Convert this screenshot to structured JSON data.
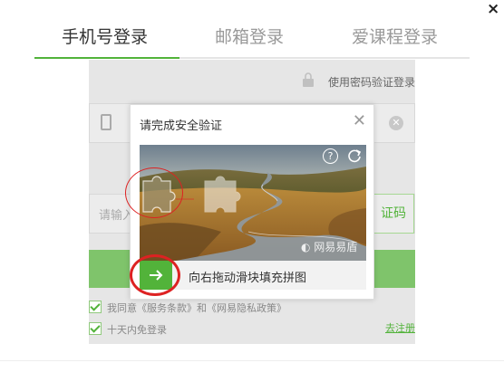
{
  "window": {
    "close_symbol": "×"
  },
  "tabs": [
    {
      "label": "手机号登录",
      "active": true
    },
    {
      "label": "邮箱登录",
      "active": false
    },
    {
      "label": "爱课程登录",
      "active": false
    }
  ],
  "form": {
    "password_login_link": "使用密码验证登录",
    "phone_placeholder": "",
    "code_placeholder": "请输入",
    "code_button_label": "证码",
    "agree_text": "我同意《服务条款》和《网易隐私政策》",
    "remember_text": "十天内免登录",
    "register_link": "去注册"
  },
  "captcha": {
    "title": "请完成安全验证",
    "help_symbol": "?",
    "watermark": "网易易盾",
    "slider_text": "向右拖动滑块填充拼图"
  },
  "colors": {
    "accent": "#52b33a",
    "annotation": "#dd2222"
  }
}
